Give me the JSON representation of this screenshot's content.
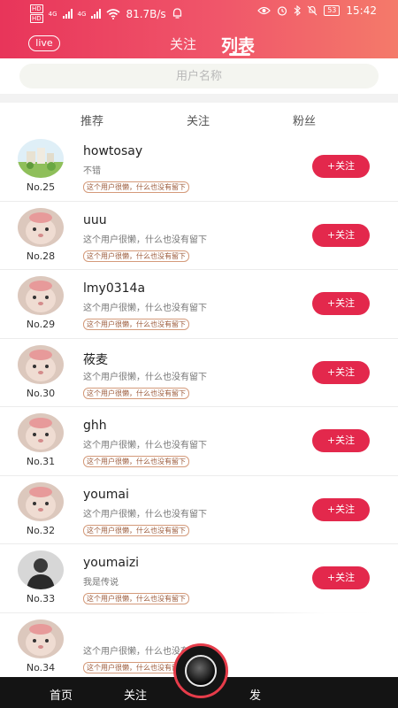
{
  "status_bar": {
    "network_speed": "81.7B/s",
    "time": "15:42",
    "battery": "53",
    "hd_label": "HD",
    "signal_label": "4G"
  },
  "header": {
    "live_label": "live",
    "tab_follow": "关注",
    "tab_list": "列表"
  },
  "search": {
    "placeholder": "用户名称"
  },
  "subtabs": [
    "推荐",
    "关注",
    "粉丝"
  ],
  "users": [
    {
      "rank": "No.25",
      "name": "howtosay",
      "sign": "不错",
      "tag": "这个用户很懒，什么也没有留下",
      "button": "+关注",
      "avatar": "avatar-scene-icon"
    },
    {
      "rank": "No.28",
      "name": "uuu",
      "sign": "这个用户很懒，什么也没有留下",
      "tag": "这个用户很懒，什么也没有留下",
      "button": "+关注",
      "avatar": "avatar-cat-icon"
    },
    {
      "rank": "No.29",
      "name": "lmy0314a",
      "sign": "这个用户很懒，什么也没有留下",
      "tag": "这个用户很懒，什么也没有留下",
      "button": "+关注",
      "avatar": "avatar-cat-icon"
    },
    {
      "rank": "No.30",
      "name": "莜麦",
      "sign": "这个用户很懒，什么也没有留下",
      "tag": "这个用户很懒，什么也没有留下",
      "button": "+关注",
      "avatar": "avatar-cat-icon"
    },
    {
      "rank": "No.31",
      "name": "ghh",
      "sign": "这个用户很懒，什么也没有留下",
      "tag": "这个用户很懒，什么也没有留下",
      "button": "+关注",
      "avatar": "avatar-cat-icon"
    },
    {
      "rank": "No.32",
      "name": "youmai",
      "sign": "这个用户很懒，什么也没有留下",
      "tag": "这个用户很懒，什么也没有留下",
      "button": "+关注",
      "avatar": "avatar-cat-icon"
    },
    {
      "rank": "No.33",
      "name": "youmaizi",
      "sign": "我是传说",
      "tag": "这个用户很懒，什么也没有留下",
      "button": "+关注",
      "avatar": "avatar-person-icon"
    },
    {
      "rank": "No.34",
      "name": "",
      "sign": "这个用户很懒，什么也没有留下",
      "tag": "这个用户很懒，什么也没有留下",
      "button": "",
      "avatar": "avatar-cat-icon"
    }
  ],
  "bottom_nav": {
    "home": "首页",
    "follow": "关注",
    "publish": "发"
  },
  "colors": {
    "accent": "#e3284c",
    "header_start": "#e8355a",
    "header_end": "#f47a6a"
  }
}
